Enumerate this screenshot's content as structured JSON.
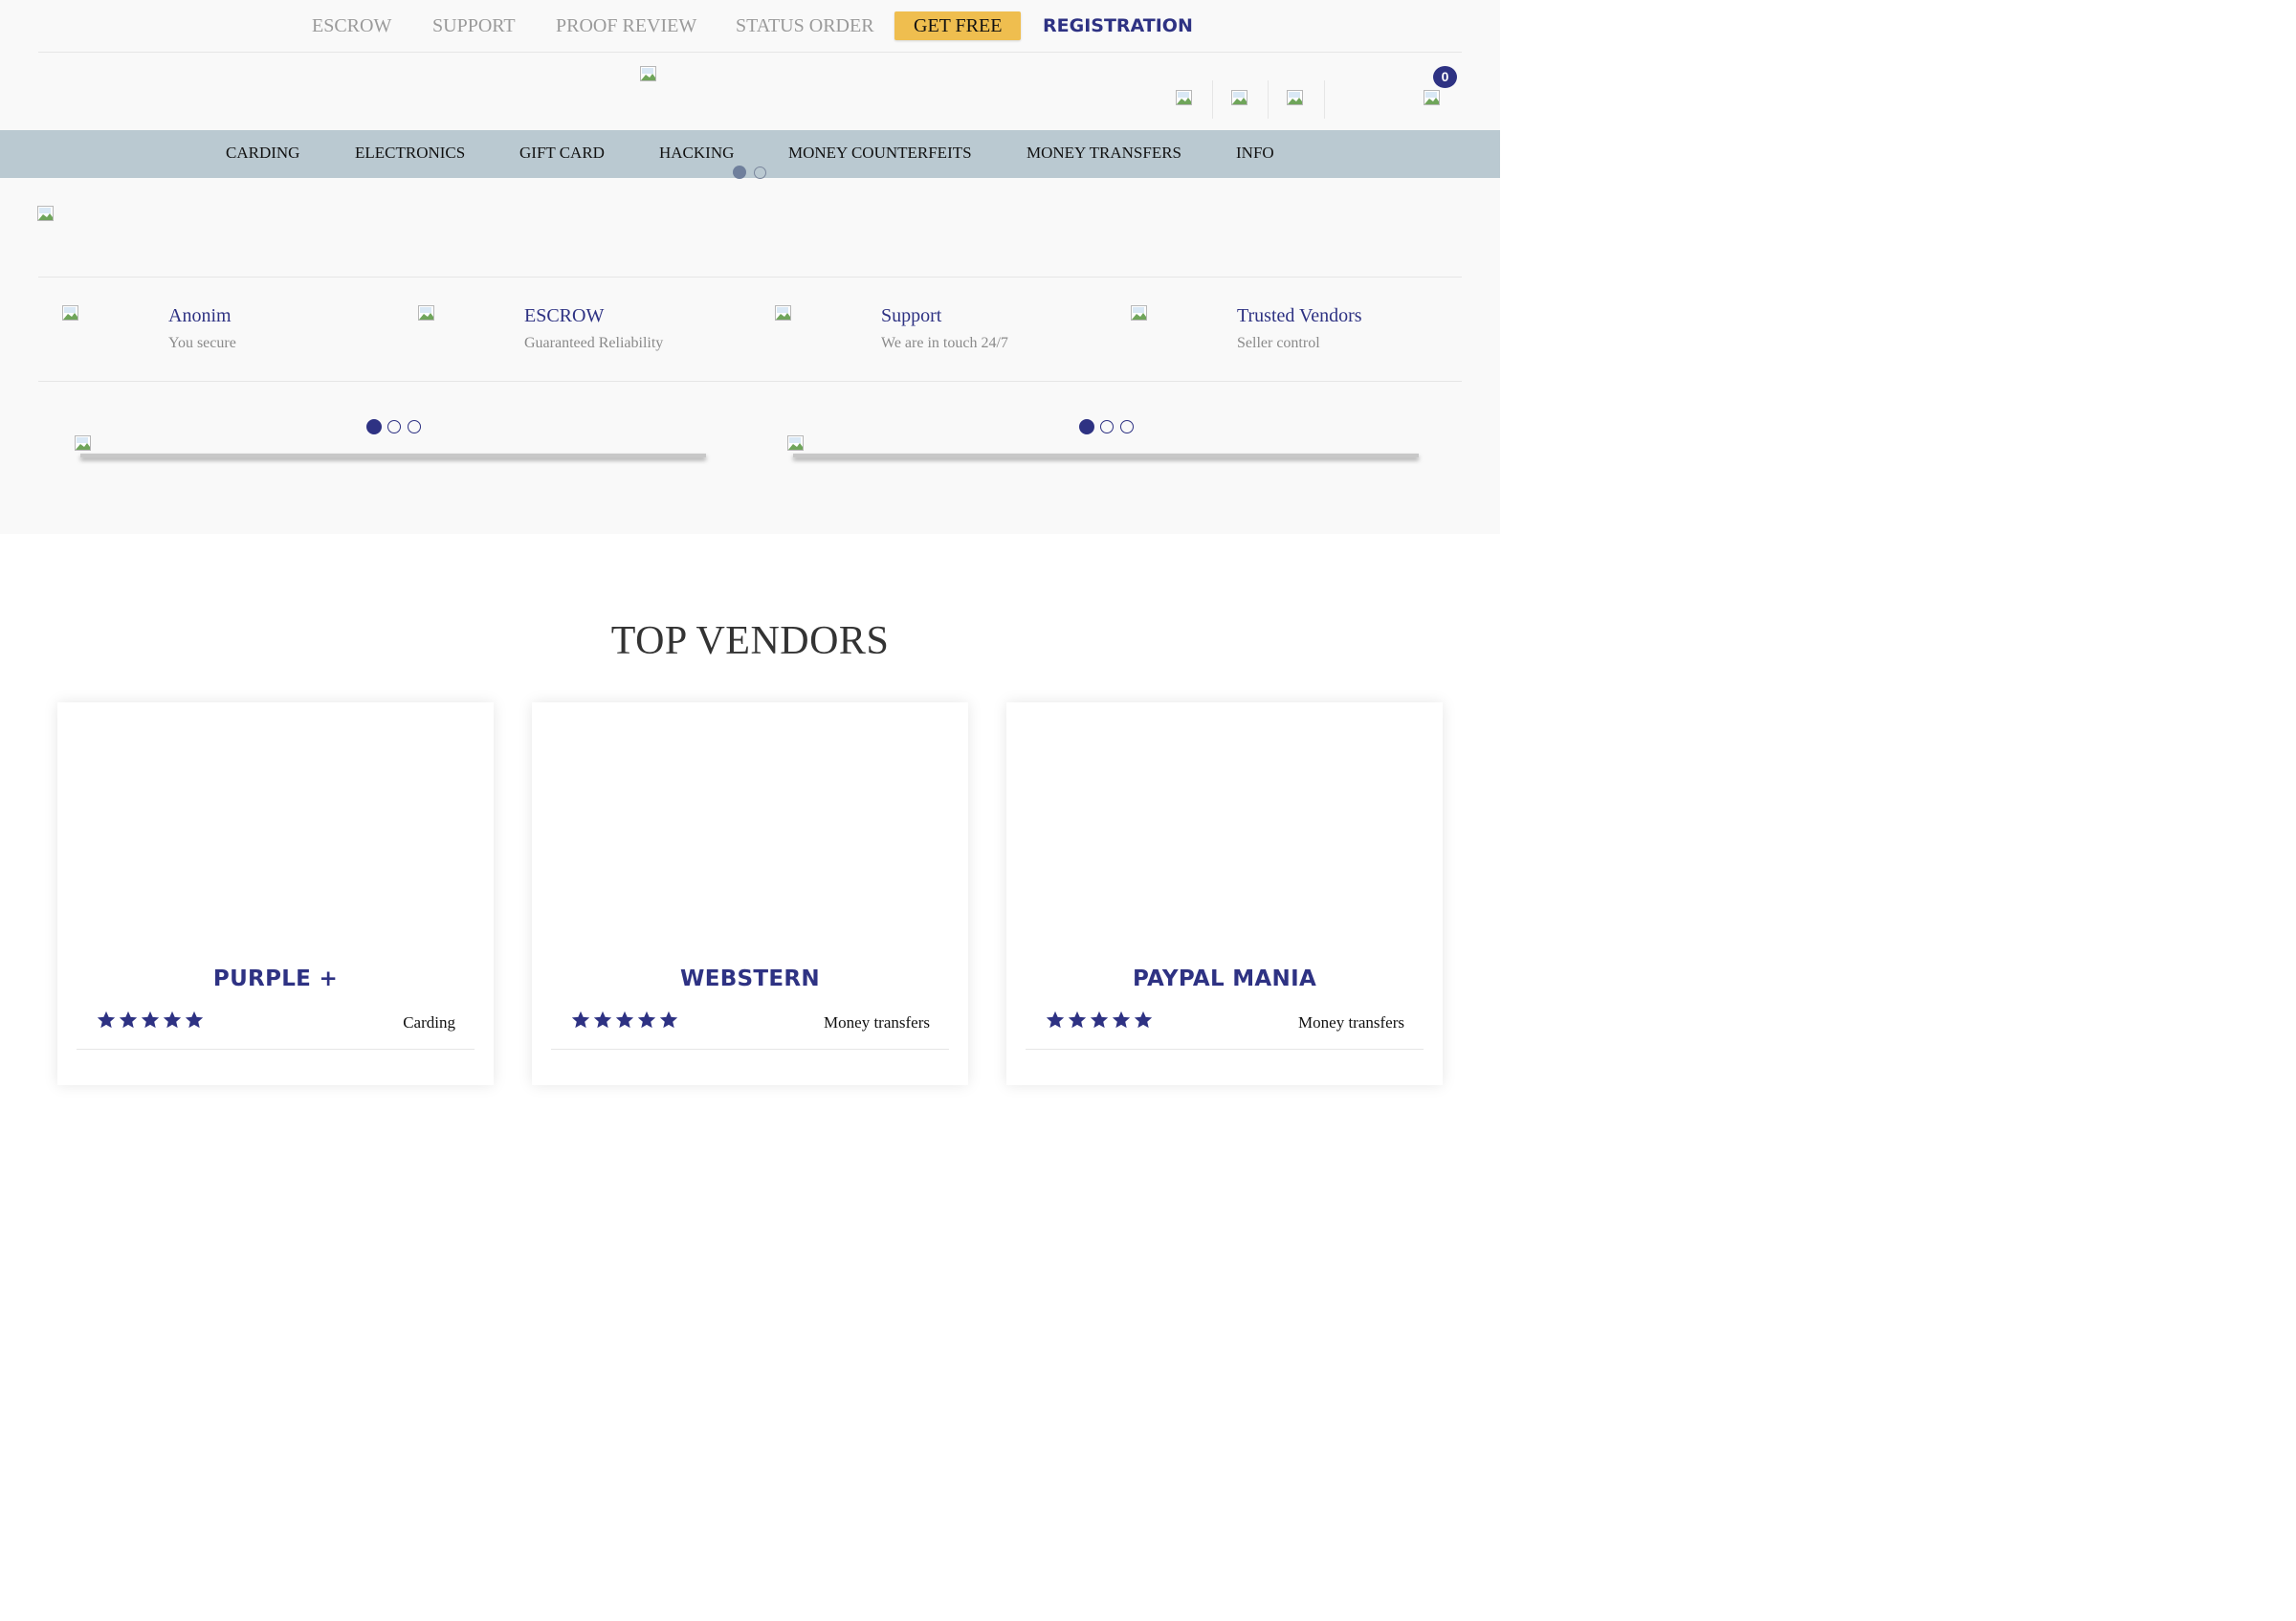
{
  "top_nav": {
    "links": [
      "ESCROW",
      "SUPPORT",
      "PROOF REVIEW",
      "STATUS ORDER"
    ],
    "get_free": "GET FREE",
    "registration": "REGISTRATION"
  },
  "header": {
    "cart_count": "0"
  },
  "main_nav": {
    "items": [
      "CARDING",
      "ELECTRONICS",
      "GIFT CARD",
      "HACKING",
      "MONEY COUNTERFEITS",
      "MONEY TRANSFERS",
      "INFO"
    ]
  },
  "features": [
    {
      "title": "Anonim",
      "subtitle": "You secure"
    },
    {
      "title": "ESCROW",
      "subtitle": "Guaranteed Reliability"
    },
    {
      "title": "Support",
      "subtitle": "We are in touch 24/7"
    },
    {
      "title": "Trusted Vendors",
      "subtitle": "Seller control"
    }
  ],
  "sliders": [
    {
      "active_index": 0,
      "count": 3
    },
    {
      "active_index": 0,
      "count": 3
    }
  ],
  "top_vendors": {
    "title": "TOP VENDORS",
    "vendors": [
      {
        "name": "PURPLE +",
        "rating": 5,
        "category": "Carding"
      },
      {
        "name": "WEBSTERN",
        "rating": 5,
        "category": "Money transfers"
      },
      {
        "name": "PAYPAL MANIA",
        "rating": 5,
        "category": "Money transfers"
      }
    ]
  },
  "colors": {
    "brand": "#2e3283",
    "get_free_bg": "#efbe4f",
    "nav_bg": "#bac9d1"
  }
}
